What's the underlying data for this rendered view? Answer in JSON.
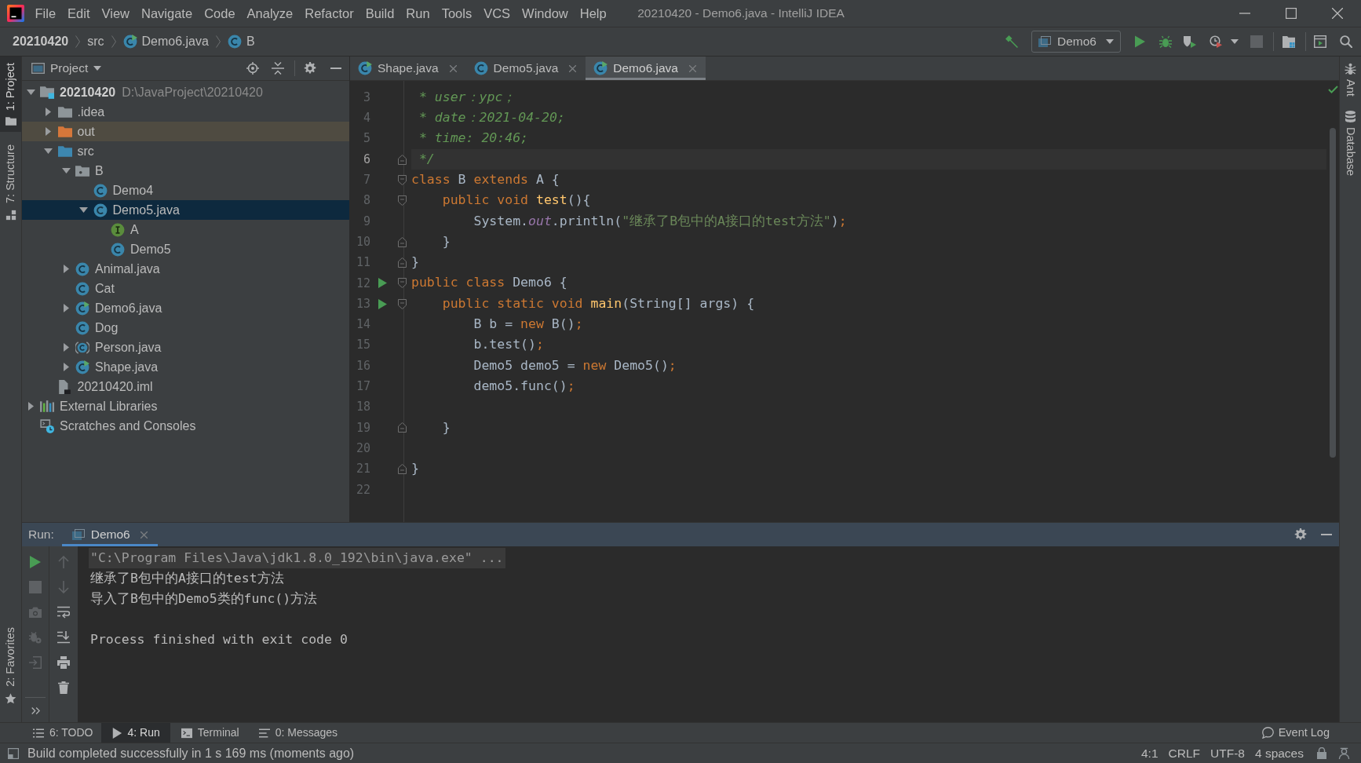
{
  "window": {
    "title": "20210420 - Demo6.java - IntelliJ IDEA"
  },
  "menu": [
    {
      "label": "File"
    },
    {
      "label": "Edit"
    },
    {
      "label": "View"
    },
    {
      "label": "Navigate"
    },
    {
      "label": "Code"
    },
    {
      "label": "Analyze"
    },
    {
      "label": "Refactor"
    },
    {
      "label": "Build"
    },
    {
      "label": "Run"
    },
    {
      "label": "Tools"
    },
    {
      "label": "VCS"
    },
    {
      "label": "Window"
    },
    {
      "label": "Help"
    }
  ],
  "breadcrumbs": [
    {
      "label": "20210420",
      "kind": "project"
    },
    {
      "label": "src",
      "kind": "directory"
    },
    {
      "label": "Demo6.java",
      "kind": "runnable_class"
    },
    {
      "label": "B",
      "kind": "class"
    }
  ],
  "toolbar": {
    "run_configuration": "Demo6",
    "actions": [
      {
        "disabled": false
      },
      {
        "disabled": false
      },
      {
        "disabled": false
      },
      {
        "disabled": false
      },
      {
        "disabled": true
      },
      {
        "disabled": false
      },
      {
        "disabled": false
      },
      {
        "disabled": false
      }
    ]
  },
  "left_strip": {
    "top": [
      {
        "label": "1: Project",
        "selected": true
      },
      {
        "label": "7: Structure",
        "selected": false
      }
    ],
    "bottom": [
      {
        "label": "2: Favorites",
        "selected": false
      }
    ]
  },
  "right_strip": [
    {
      "label": "Ant"
    },
    {
      "label": "Database"
    }
  ],
  "project_panel": {
    "title": "Project",
    "tree": [
      {
        "label": "20210420",
        "path": "D:\\JavaProject\\20210420",
        "kind": "module",
        "expanded": true,
        "selected": false,
        "children": [
          {
            "label": ".idea",
            "kind": "folder",
            "expanded": false,
            "selected": false
          },
          {
            "label": "out",
            "kind": "excluded_folder",
            "expanded": false,
            "selected": false
          },
          {
            "label": "src",
            "kind": "source_folder",
            "expanded": true,
            "selected": false,
            "children": [
              {
                "label": "B",
                "kind": "package",
                "expanded": true,
                "selected": false,
                "children": [
                  {
                    "label": "Demo4",
                    "kind": "class",
                    "selected": false
                  },
                  {
                    "label": "Demo5.java",
                    "kind": "class",
                    "expanded": true,
                    "selected": true,
                    "children": [
                      {
                        "label": "A",
                        "kind": "interface",
                        "selected": false
                      },
                      {
                        "label": "Demo5",
                        "kind": "class",
                        "selected": false
                      }
                    ]
                  }
                ]
              },
              {
                "label": "Animal.java",
                "kind": "class",
                "expanded": false,
                "selected": false
              },
              {
                "label": "Cat",
                "kind": "class",
                "selected": false
              },
              {
                "label": "Demo6.java",
                "kind": "runnable_class",
                "expanded": false,
                "selected": false
              },
              {
                "label": "Dog",
                "kind": "class",
                "selected": false
              },
              {
                "label": "Person.java",
                "kind": "abstract_class",
                "expanded": false,
                "selected": false
              },
              {
                "label": "Shape.java",
                "kind": "runnable_class",
                "expanded": false,
                "selected": false
              }
            ]
          },
          {
            "label": "20210420.iml",
            "kind": "module_file",
            "selected": false
          }
        ]
      },
      {
        "label": "External Libraries",
        "kind": "libraries",
        "expanded": false,
        "selected": false
      },
      {
        "label": "Scratches and Consoles",
        "kind": "scratches",
        "selected": false
      }
    ]
  },
  "editor": {
    "tabs": [
      {
        "label": "Shape.java",
        "kind": "runnable_class",
        "selected": false
      },
      {
        "label": "Demo5.java",
        "kind": "class",
        "selected": false
      },
      {
        "label": "Demo6.java",
        "kind": "runnable_class",
        "selected": true
      }
    ],
    "lines": [
      {
        "number": "3",
        "current": false,
        "run_marker": false,
        "fold_start": false,
        "fold_end": false,
        "tokens": [
          {
            "kind": "doc",
            "text": " * user：ypc；"
          }
        ]
      },
      {
        "number": "4",
        "current": false,
        "run_marker": false,
        "fold_start": false,
        "fold_end": false,
        "tokens": [
          {
            "kind": "doc",
            "text": " * date：2021-04-20;"
          }
        ]
      },
      {
        "number": "5",
        "current": false,
        "run_marker": false,
        "fold_start": false,
        "fold_end": false,
        "tokens": [
          {
            "kind": "doc",
            "text": " * time: 20:46;"
          }
        ]
      },
      {
        "number": "6",
        "current": true,
        "run_marker": false,
        "fold_start": false,
        "fold_end": true,
        "tokens": [
          {
            "kind": "doc",
            "text": " */"
          }
        ]
      },
      {
        "number": "7",
        "current": false,
        "run_marker": false,
        "fold_start": true,
        "fold_end": false,
        "tokens": [
          {
            "kind": "keyword",
            "text": "class "
          },
          {
            "kind": "plain",
            "text": "B "
          },
          {
            "kind": "keyword",
            "text": "extends "
          },
          {
            "kind": "plain",
            "text": "A {"
          }
        ]
      },
      {
        "number": "8",
        "current": false,
        "run_marker": false,
        "fold_start": true,
        "fold_end": false,
        "tokens": [
          {
            "kind": "keyword",
            "text": "    public void "
          },
          {
            "kind": "method",
            "text": "test"
          },
          {
            "kind": "plain",
            "text": "(){"
          }
        ]
      },
      {
        "number": "9",
        "current": false,
        "run_marker": false,
        "fold_start": false,
        "fold_end": false,
        "tokens": [
          {
            "kind": "plain",
            "text": "        System."
          },
          {
            "kind": "static_field",
            "text": "out"
          },
          {
            "kind": "plain",
            "text": ".println("
          },
          {
            "kind": "string",
            "text": "\"继承了B包中的A接口的test方法\""
          },
          {
            "kind": "plain",
            "text": ")"
          },
          {
            "kind": "keyword",
            "text": ";"
          }
        ]
      },
      {
        "number": "10",
        "current": false,
        "run_marker": false,
        "fold_start": false,
        "fold_end": true,
        "tokens": [
          {
            "kind": "plain",
            "text": "    }"
          }
        ]
      },
      {
        "number": "11",
        "current": false,
        "run_marker": false,
        "fold_start": false,
        "fold_end": true,
        "tokens": [
          {
            "kind": "plain",
            "text": "}"
          }
        ]
      },
      {
        "number": "12",
        "current": false,
        "run_marker": true,
        "fold_start": true,
        "fold_end": false,
        "tokens": [
          {
            "kind": "keyword",
            "text": "public class "
          },
          {
            "kind": "plain",
            "text": "Demo6 {"
          }
        ]
      },
      {
        "number": "13",
        "current": false,
        "run_marker": true,
        "fold_start": true,
        "fold_end": false,
        "tokens": [
          {
            "kind": "keyword",
            "text": "    public static void "
          },
          {
            "kind": "method",
            "text": "main"
          },
          {
            "kind": "plain",
            "text": "(String[] args) {"
          }
        ]
      },
      {
        "number": "14",
        "current": false,
        "run_marker": false,
        "fold_start": false,
        "fold_end": false,
        "tokens": [
          {
            "kind": "plain",
            "text": "        B b = "
          },
          {
            "kind": "keyword",
            "text": "new "
          },
          {
            "kind": "plain",
            "text": "B()"
          },
          {
            "kind": "keyword",
            "text": ";"
          }
        ]
      },
      {
        "number": "15",
        "current": false,
        "run_marker": false,
        "fold_start": false,
        "fold_end": false,
        "tokens": [
          {
            "kind": "plain",
            "text": "        b.test()"
          },
          {
            "kind": "keyword",
            "text": ";"
          }
        ]
      },
      {
        "number": "16",
        "current": false,
        "run_marker": false,
        "fold_start": false,
        "fold_end": false,
        "tokens": [
          {
            "kind": "plain",
            "text": "        Demo5 demo5 = "
          },
          {
            "kind": "keyword",
            "text": "new "
          },
          {
            "kind": "plain",
            "text": "Demo5()"
          },
          {
            "kind": "keyword",
            "text": ";"
          }
        ]
      },
      {
        "number": "17",
        "current": false,
        "run_marker": false,
        "fold_start": false,
        "fold_end": false,
        "tokens": [
          {
            "kind": "plain",
            "text": "        demo5.func()"
          },
          {
            "kind": "keyword",
            "text": ";"
          }
        ]
      },
      {
        "number": "18",
        "current": false,
        "run_marker": false,
        "fold_start": false,
        "fold_end": false
      },
      {
        "number": "19",
        "current": false,
        "run_marker": false,
        "fold_start": false,
        "fold_end": true,
        "tokens": [
          {
            "kind": "plain",
            "text": "    }"
          }
        ]
      },
      {
        "number": "20",
        "current": false,
        "run_marker": false,
        "fold_start": false,
        "fold_end": false
      },
      {
        "number": "21",
        "current": false,
        "run_marker": false,
        "fold_start": false,
        "fold_end": true,
        "tokens": [
          {
            "kind": "plain",
            "text": "}"
          }
        ]
      },
      {
        "number": "22",
        "current": false,
        "run_marker": false,
        "fold_start": false,
        "fold_end": false
      }
    ]
  },
  "run_panel": {
    "label": "Run:",
    "tabs": [
      {
        "label": "Demo6",
        "selected": true
      }
    ],
    "left_tools": [
      {
        "disabled": false
      },
      {
        "disabled": true
      },
      {
        "disabled": true
      },
      {
        "disabled": true
      },
      {
        "disabled": true
      }
    ],
    "right_tools": [
      {
        "disabled": true
      },
      {
        "disabled": true
      },
      {
        "disabled": false
      },
      {
        "disabled": false
      },
      {
        "disabled": false
      },
      {
        "disabled": false
      }
    ],
    "console": [
      {
        "kind": "command",
        "text": "\"C:\\Program Files\\Java\\jdk1.8.0_192\\bin\\java.exe\" ..."
      },
      {
        "kind": "output",
        "text": "继承了B包中的A接口的test方法"
      },
      {
        "kind": "output",
        "text": "导入了B包中的Demo5类的func()方法"
      },
      {
        "kind": "exit",
        "text": "Process finished with exit code 0"
      }
    ]
  },
  "tool_tabs": [
    {
      "label": "6: TODO",
      "selected": false
    },
    {
      "label": "4: Run",
      "selected": true
    },
    {
      "label": "Terminal",
      "selected": false
    },
    {
      "label": "0: Messages",
      "selected": false
    }
  ],
  "event_log": "Event Log",
  "status_bar": {
    "message": "Build completed successfully in 1 s 169 ms (moments ago)",
    "items": [
      "4:1",
      "CRLF",
      "UTF-8",
      "4 spaces"
    ]
  }
}
